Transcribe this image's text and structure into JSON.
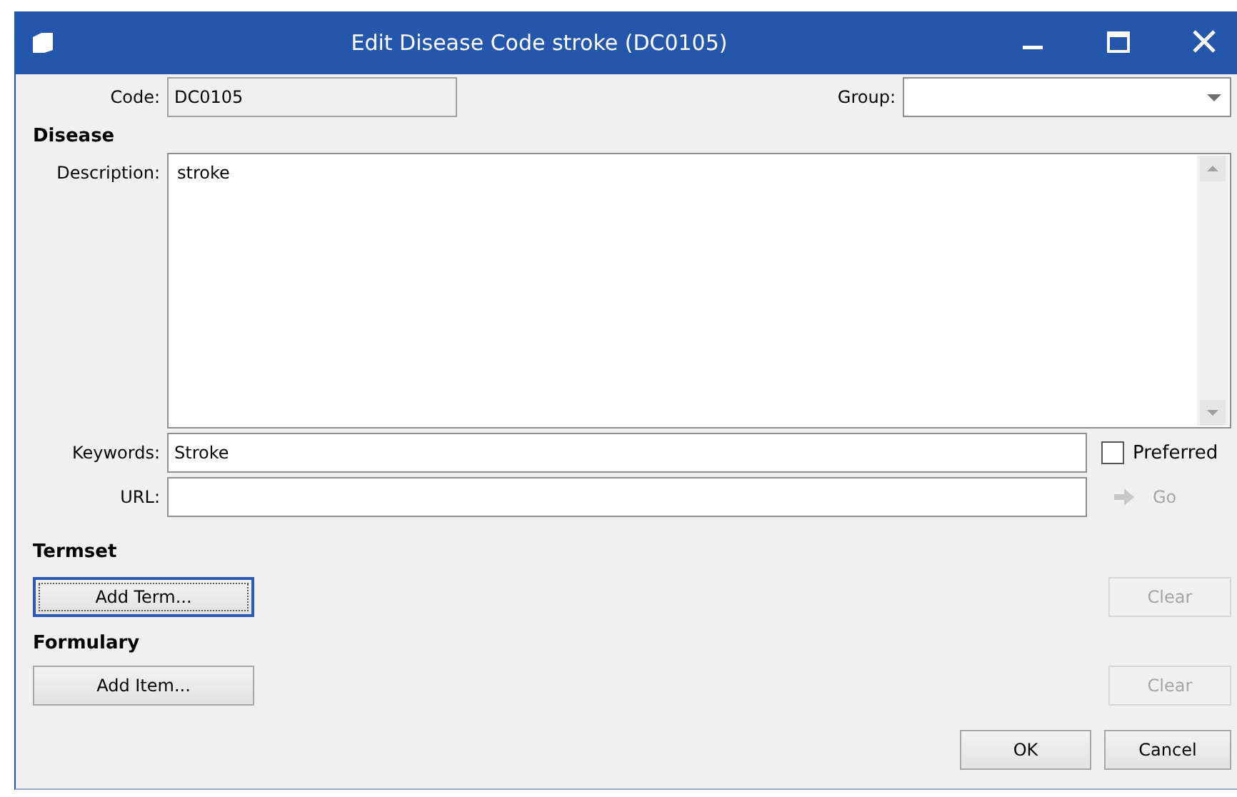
{
  "window": {
    "title": "Edit Disease Code stroke (DC0105)"
  },
  "code": {
    "label": "Code:",
    "value": "DC0105",
    "disabled": true
  },
  "group": {
    "label": "Group:"
  },
  "disease": {
    "heading": "Disease",
    "description": {
      "label": "Description:",
      "value": "stroke"
    },
    "keywords": {
      "label": "Keywords:",
      "value": "Stroke"
    },
    "preferred": {
      "label": "Preferred",
      "checked": false
    },
    "url": {
      "label": "URL:"
    },
    "go": {
      "label": "Go",
      "disabled": true
    }
  },
  "termset": {
    "heading": "Termset",
    "add_button": {
      "label": "Add Term...",
      "focused": true,
      "disabled": false
    },
    "clear_button": {
      "label": "Clear",
      "focused": false,
      "disabled": true
    }
  },
  "formulary": {
    "heading": "Formulary",
    "add_button": {
      "label": "Add Item...",
      "focused": false,
      "disabled": false
    },
    "clear_button": {
      "label": "Clear",
      "focused": false,
      "disabled": true
    }
  },
  "buttons": [
    {
      "label": "OK"
    },
    {
      "label": "Cancel"
    }
  ]
}
